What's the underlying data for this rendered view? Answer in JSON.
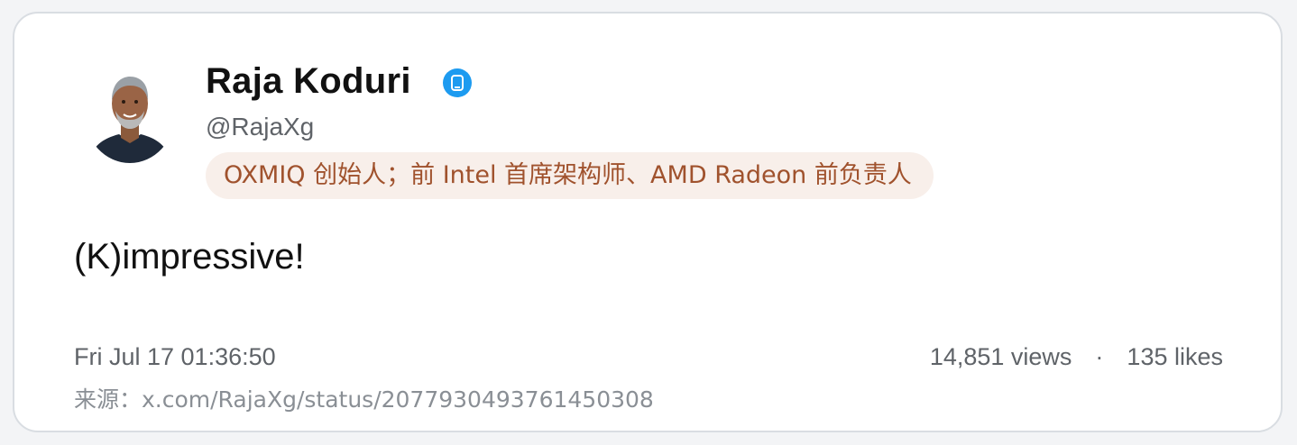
{
  "author": {
    "name": "Raja Koduri",
    "handle": "@RajaXg",
    "verified_icon": "verified-badge-icon",
    "verified_color": "#1d9bf0",
    "bio": "OXMIQ 创始人；前 Intel 首席架构师、AMD Radeon 前负责人"
  },
  "tweet": {
    "text": "(K)impressive!",
    "timestamp": "Fri Jul 17 01:36:50"
  },
  "stats": {
    "views": "14,851 views",
    "separator": "·",
    "likes": "135 likes"
  },
  "source": {
    "text": "来源：x.com/RajaXg/status/2077930493761450308"
  },
  "colors": {
    "bio_text": "#a0522d",
    "bio_background": "#f8efea",
    "card_border": "#d9dde2"
  }
}
